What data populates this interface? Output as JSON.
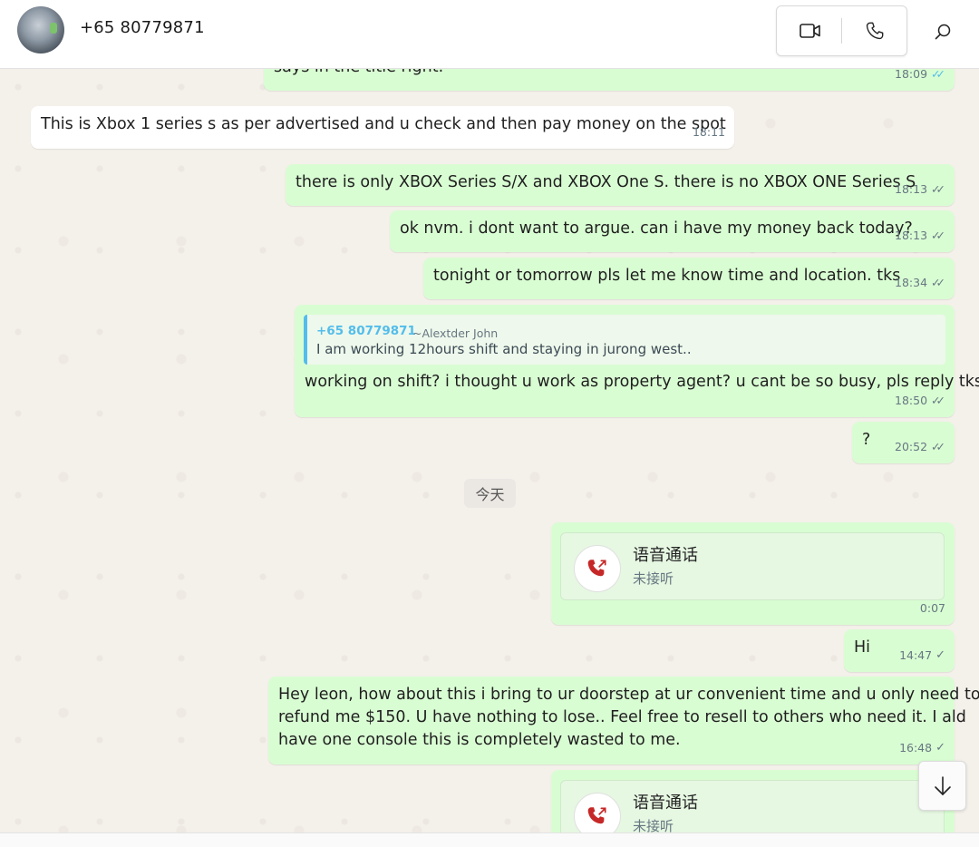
{
  "header": {
    "title": "+65 80779871",
    "icons": [
      "avatar",
      "video-call-icon",
      "voice-call-icon",
      "search-icon"
    ]
  },
  "messages": {
    "m0": {
      "text": "says in the title right.",
      "time": "18:09"
    },
    "m1": {
      "text": "This is Xbox 1 series s as per advertised and u check and then pay money on the spot",
      "time": "18:11"
    },
    "m2": {
      "text": "there is only XBOX Series S/X and XBOX One S. there is no XBOX ONE Series S",
      "time": "18:13"
    },
    "m3": {
      "text": "ok nvm. i dont want to argue. can i have my money back today?",
      "time": "18:13"
    },
    "m4": {
      "text": "tonight or tomorrow pls let me know time and location. tks",
      "time": "18:34"
    },
    "m5": {
      "quote_name": "+65 80779871",
      "quote_alias": "~Alextder John",
      "quote_text": "I am working 12hours shift and staying in jurong west..",
      "text": "working on shift? i thought u work as property agent? u cant be so busy, pls reply tks",
      "time": "18:50"
    },
    "m6": {
      "text": "?",
      "time": "20:52"
    },
    "date_divider": "今天",
    "call1": {
      "title": "语音通话",
      "status": "未接听",
      "duration": "0:07"
    },
    "m7": {
      "text": "Hi",
      "time": "14:47"
    },
    "m8": {
      "line1": "Hey leon, how about this i bring to ur doorstep at ur convenient time and u only need to",
      "line2": "refund me $150. U have nothing to lose.. Feel free to resell to others who need it. I ald",
      "line3": "have one console this is completely wasted to me.",
      "time": "16:48"
    },
    "call2": {
      "title": "语音通话",
      "status": "未接听"
    }
  },
  "colors": {
    "outgoing_bubble": "#d9fdd3",
    "incoming_bubble": "#ffffff",
    "read_tick": "#53bdeb",
    "missed_call": "#c62828"
  }
}
